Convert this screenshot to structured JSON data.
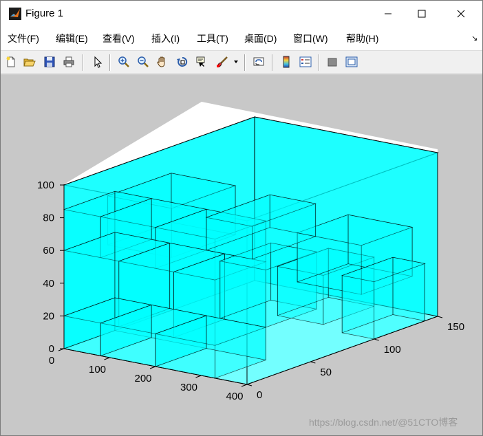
{
  "window": {
    "title": "Figure 1",
    "controls": {
      "minimize": "—",
      "maximize": "☐",
      "close": "✕"
    }
  },
  "menu": {
    "items": [
      "文件(F)",
      "编辑(E)",
      "查看(V)",
      "插入(I)",
      "工具(T)",
      "桌面(D)",
      "窗口(W)",
      "帮助(H)"
    ],
    "dock_arrow": "↘"
  },
  "toolbar": {
    "buttons": [
      "new-figure-icon",
      "open-file-icon",
      "save-icon",
      "print-icon",
      "edit-plot-arrow-icon",
      "zoom-in-icon",
      "zoom-out-icon",
      "pan-hand-icon",
      "rotate-3d-icon",
      "data-cursor-icon",
      "brush-icon",
      "brush-dropdown-icon",
      "link-plot-icon",
      "colorbar-icon",
      "legend-icon",
      "hide-plot-tools-icon",
      "show-plot-tools-icon"
    ]
  },
  "plot": {
    "box_color": "#00ffff",
    "edge_color": "#000000",
    "background": "#c8c8c8",
    "axes_face": "#ffffff",
    "z_ticks": [
      "0",
      "20",
      "40",
      "60",
      "80",
      "100"
    ],
    "x_ticks": [
      "0",
      "100",
      "200",
      "300",
      "400"
    ],
    "y_ticks": [
      "0",
      "50",
      "100",
      "150"
    ]
  },
  "watermark": "https://blog.csdn.net/@51CTO博客"
}
